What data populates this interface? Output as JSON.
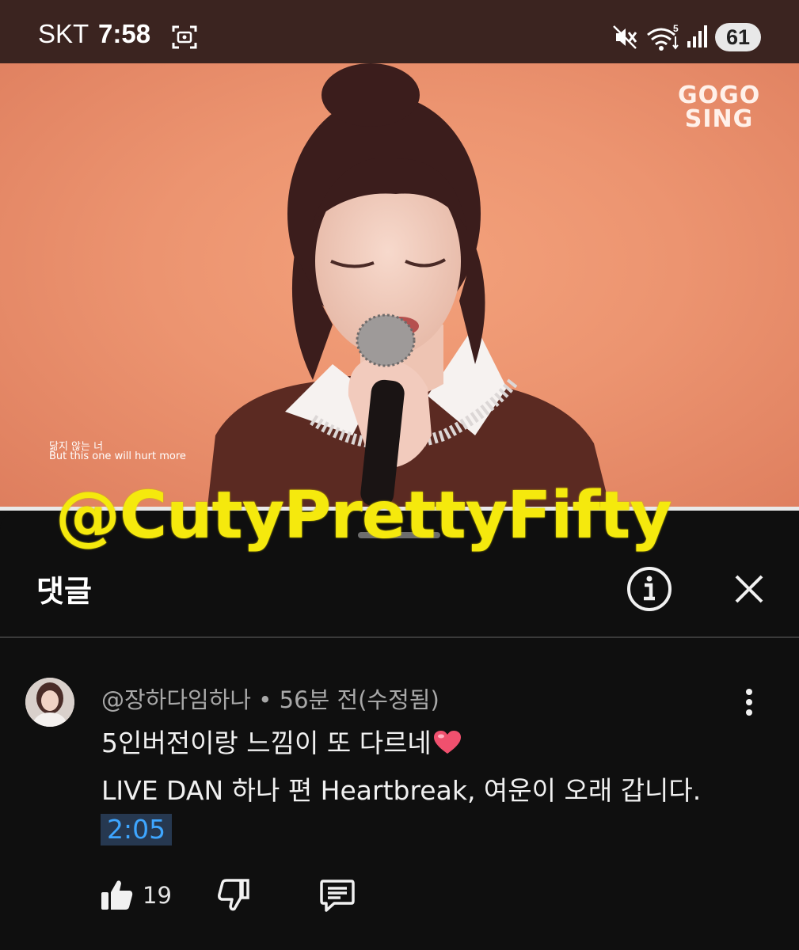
{
  "status_bar": {
    "carrier": "SKT",
    "time": "7:58",
    "battery": "61",
    "icons": [
      "screenshot-icon",
      "mute-icon",
      "wifi-icon",
      "signal-icon",
      "battery-icon"
    ]
  },
  "video": {
    "logo_line1": "GOGO",
    "logo_line2": "SING",
    "subtitle_ko": "닮지 않는 너",
    "subtitle_en": "But this one will hurt more"
  },
  "watermark": "@CutyPrettyFifty",
  "sheet": {
    "title": "댓글",
    "icons": [
      "info-icon",
      "close-icon"
    ]
  },
  "comment": {
    "author": "@장하다임하나",
    "separator": " • ",
    "time": "56분 전(수정됨)",
    "line1": "5인버전이랑 느낌이 또 다르네",
    "line2": "LIVE DAN 하나 편 Heartbreak, 여운이 오래 갑니다.",
    "timestamp": "2:05",
    "like_count": "19",
    "icons": [
      "heart-icon",
      "more-icon",
      "like-icon",
      "dislike-icon",
      "reply-icon"
    ]
  },
  "colors": {
    "status_bar_bg": "#3b2420",
    "video_bg": "#ec9470",
    "sheet_bg": "#0f0f0f",
    "watermark": "#f5e90d",
    "timestamp_link": "#3ea6ff",
    "heart": "#f0506e"
  }
}
